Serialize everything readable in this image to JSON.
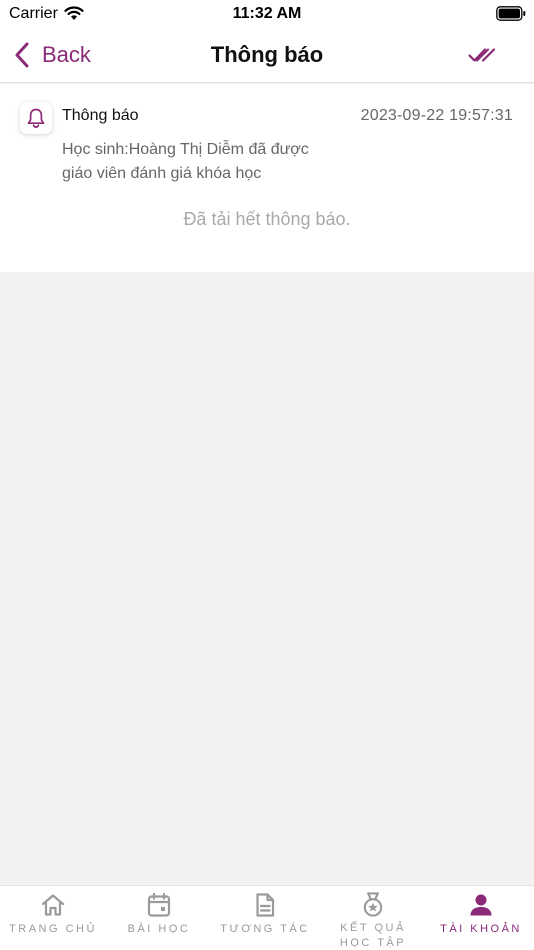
{
  "status_bar": {
    "carrier": "Carrier",
    "time": "11:32 AM",
    "wifi_icon": "wifi-icon",
    "battery_icon": "battery-icon"
  },
  "nav": {
    "back_label": "Back",
    "title": "Thông báo",
    "mark_all_read_icon": "double-check-icon"
  },
  "notifications": [
    {
      "icon": "bell-icon",
      "title": "Thông báo",
      "time": "2023-09-22 19:57:31",
      "body": "Học sinh:Hoàng Thị Diễm đã được giáo viên đánh giá khóa học"
    }
  ],
  "end_message": "Đã tải hết thông báo.",
  "tabs": [
    {
      "label": "TRANG CHỦ",
      "icon": "home-icon",
      "active": false
    },
    {
      "label": "BÀI HỌC",
      "icon": "calendar-icon",
      "active": false
    },
    {
      "label": "TƯƠNG TÁC",
      "icon": "document-icon",
      "active": false
    },
    {
      "label": "KẾT QUẢ HỌC TẬP",
      "icon": "medal-icon",
      "active": false
    },
    {
      "label": "TÀI KHOẢN",
      "icon": "user-icon",
      "active": true
    }
  ],
  "colors": {
    "accent": "#8a2a78",
    "inactive": "#9a9a9a",
    "background": "#f2f2f2"
  }
}
